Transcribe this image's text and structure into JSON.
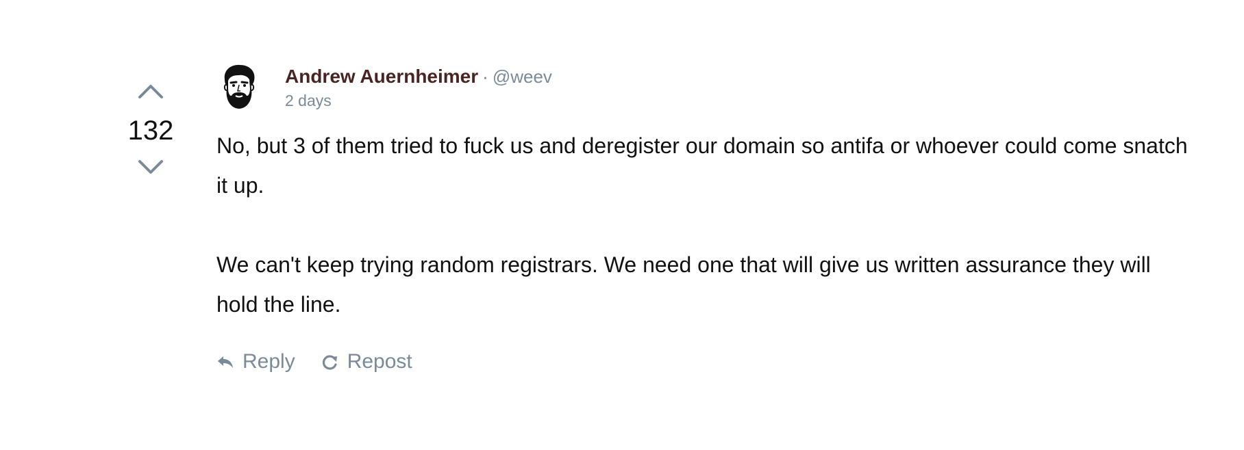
{
  "vote": {
    "count": "132"
  },
  "post": {
    "author": "Andrew Auernheimer",
    "separator": "·",
    "handle": "@weev",
    "time": "2 days",
    "paragraphs": [
      "No, but 3 of them tried to fuck us and deregister our domain so antifa or whoever could come snatch it up.",
      "We can't keep trying random registrars. We need one that will give us written assurance they will hold the line."
    ]
  },
  "actions": {
    "reply_label": "Reply",
    "repost_label": "Repost"
  },
  "icons": {
    "upvote": "chevron-up-icon",
    "downvote": "chevron-down-icon",
    "reply": "reply-icon",
    "repost": "repost-icon"
  },
  "colors": {
    "author": "#4a2323",
    "muted": "#7a8a99",
    "text": "#111111"
  }
}
